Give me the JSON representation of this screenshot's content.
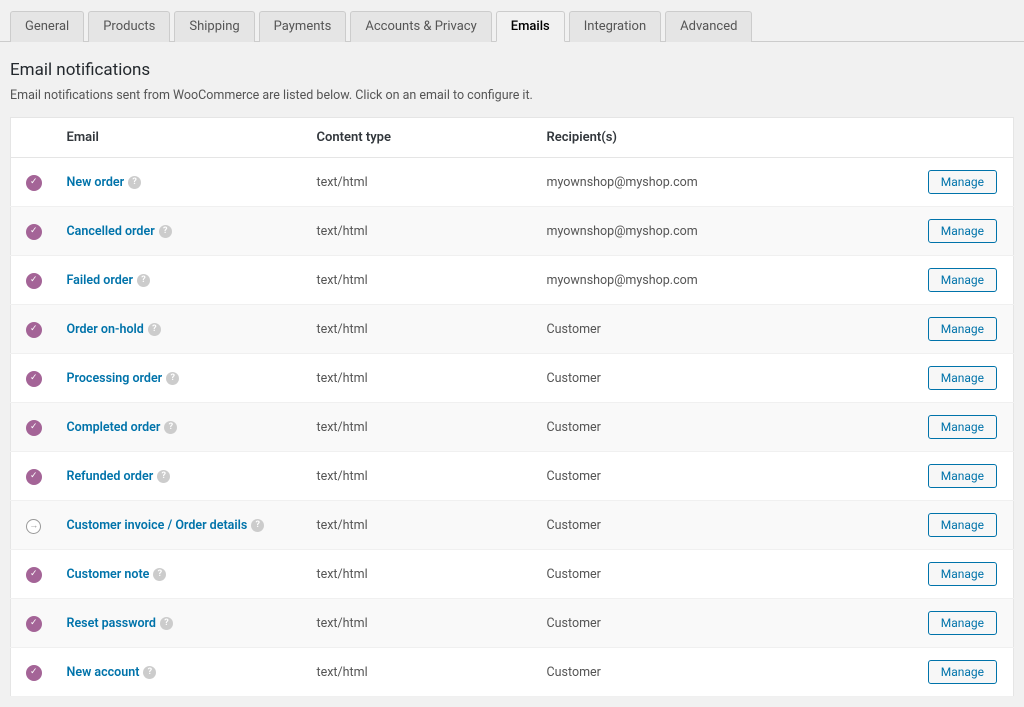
{
  "tabs": [
    {
      "label": "General",
      "active": false
    },
    {
      "label": "Products",
      "active": false
    },
    {
      "label": "Shipping",
      "active": false
    },
    {
      "label": "Payments",
      "active": false
    },
    {
      "label": "Accounts & Privacy",
      "active": false
    },
    {
      "label": "Emails",
      "active": true
    },
    {
      "label": "Integration",
      "active": false
    },
    {
      "label": "Advanced",
      "active": false
    }
  ],
  "section": {
    "title": "Email notifications",
    "description": "Email notifications sent from WooCommerce are listed below. Click on an email to configure it."
  },
  "columns": {
    "status": "",
    "email": "Email",
    "content_type": "Content type",
    "recipients": "Recipient(s)",
    "manage": ""
  },
  "manage_label": "Manage",
  "rows": [
    {
      "status": "enabled",
      "name": "New order",
      "content_type": "text/html",
      "recipient": "myownshop@myshop.com"
    },
    {
      "status": "enabled",
      "name": "Cancelled order",
      "content_type": "text/html",
      "recipient": "myownshop@myshop.com"
    },
    {
      "status": "enabled",
      "name": "Failed order",
      "content_type": "text/html",
      "recipient": "myownshop@myshop.com"
    },
    {
      "status": "enabled",
      "name": "Order on-hold",
      "content_type": "text/html",
      "recipient": "Customer"
    },
    {
      "status": "enabled",
      "name": "Processing order",
      "content_type": "text/html",
      "recipient": "Customer"
    },
    {
      "status": "enabled",
      "name": "Completed order",
      "content_type": "text/html",
      "recipient": "Customer"
    },
    {
      "status": "enabled",
      "name": "Refunded order",
      "content_type": "text/html",
      "recipient": "Customer"
    },
    {
      "status": "manual",
      "name": "Customer invoice / Order details",
      "content_type": "text/html",
      "recipient": "Customer"
    },
    {
      "status": "enabled",
      "name": "Customer note",
      "content_type": "text/html",
      "recipient": "Customer"
    },
    {
      "status": "enabled",
      "name": "Reset password",
      "content_type": "text/html",
      "recipient": "Customer"
    },
    {
      "status": "enabled",
      "name": "New account",
      "content_type": "text/html",
      "recipient": "Customer"
    }
  ]
}
